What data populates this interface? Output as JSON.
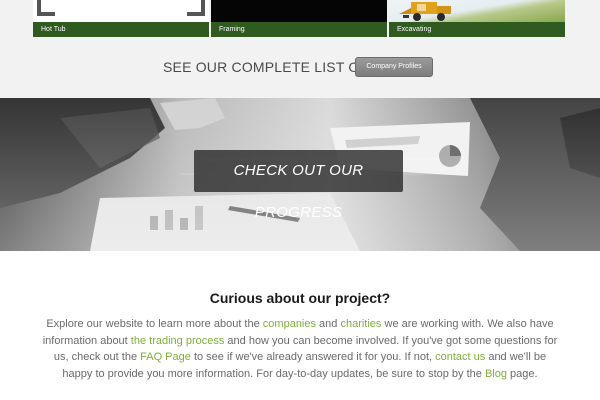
{
  "gallery": {
    "tiles": [
      {
        "caption": "Hot Tub"
      },
      {
        "caption": "Framing"
      },
      {
        "caption": "Excavating"
      }
    ]
  },
  "list_section": {
    "text": "SEE OUR COMPLETE LIST OF",
    "button_label": "Company Profiles"
  },
  "hero": {
    "button_label": "CHECK OUT OUR PROGRESS"
  },
  "info": {
    "title": "Curious about our project?",
    "t1": "Explore our website to learn more about the ",
    "link_companies": "companies",
    "t2": " and ",
    "link_charities": "charities",
    "t3": " we are working with. We also have information about ",
    "link_trading": "the trading process",
    "t4": " and how you can become involved. If you've got some questions for us, check out the ",
    "link_faq": "FAQ Page",
    "t5": " to see if we've already answered it for you. If not, ",
    "link_contact": "contact us",
    "t6": " and we'll be happy to provide you more information. For day-to-day updates, be sure to stop by the ",
    "link_blog": "Blog",
    "t7": " page."
  },
  "colors": {
    "caption_bar": "#2f5b20",
    "link": "#7fae3a",
    "button_gray": "#8a8a8a"
  }
}
